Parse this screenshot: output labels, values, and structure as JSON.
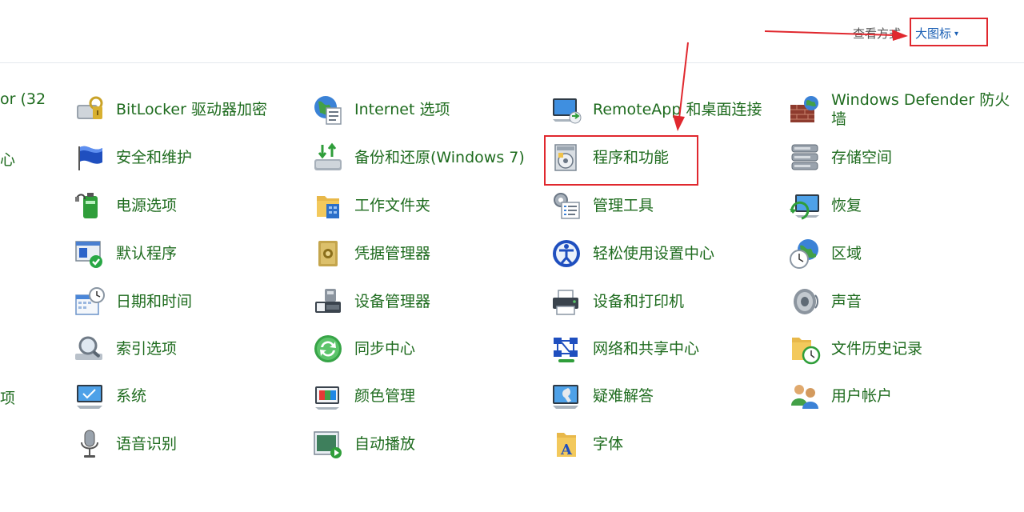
{
  "header": {
    "view_by_label": "查看方式",
    "view_by_value": "大图标"
  },
  "partial_left": [
    "or (32",
    "心",
    "项"
  ],
  "columns": [
    [
      {
        "label": "BitLocker 驱动器加密",
        "icon": "bitlocker-icon"
      },
      {
        "label": "安全和维护",
        "icon": "security-flag-icon"
      },
      {
        "label": "电源选项",
        "icon": "power-battery-icon"
      },
      {
        "label": "默认程序",
        "icon": "default-programs-icon"
      },
      {
        "label": "日期和时间",
        "icon": "calendar-clock-icon"
      },
      {
        "label": "索引选项",
        "icon": "indexing-magnifier-icon"
      },
      {
        "label": "系统",
        "icon": "system-monitor-icon"
      },
      {
        "label": "语音识别",
        "icon": "microphone-icon"
      }
    ],
    [
      {
        "label": "Internet 选项",
        "icon": "internet-globe-icon"
      },
      {
        "label": "备份和还原(Windows 7)",
        "icon": "backup-restore-icon"
      },
      {
        "label": "工作文件夹",
        "icon": "work-folders-icon"
      },
      {
        "label": "凭据管理器",
        "icon": "credential-safe-icon"
      },
      {
        "label": "设备管理器",
        "icon": "device-manager-icon"
      },
      {
        "label": "同步中心",
        "icon": "sync-center-icon"
      },
      {
        "label": "颜色管理",
        "icon": "color-management-icon"
      },
      {
        "label": "自动播放",
        "icon": "autoplay-icon"
      }
    ],
    [
      {
        "label": "RemoteApp 和桌面连接",
        "icon": "remote-desktop-icon"
      },
      {
        "label": "程序和功能",
        "icon": "programs-features-icon"
      },
      {
        "label": "管理工具",
        "icon": "admin-tools-icon"
      },
      {
        "label": "轻松使用设置中心",
        "icon": "ease-of-access-icon"
      },
      {
        "label": "设备和打印机",
        "icon": "printer-icon"
      },
      {
        "label": "网络和共享中心",
        "icon": "network-sharing-icon"
      },
      {
        "label": "疑难解答",
        "icon": "troubleshooting-icon"
      },
      {
        "label": "字体",
        "icon": "fonts-folder-icon"
      }
    ],
    [
      {
        "label": "Windows Defender 防火墙",
        "icon": "firewall-icon"
      },
      {
        "label": "存储空间",
        "icon": "storage-spaces-icon"
      },
      {
        "label": "恢复",
        "icon": "recovery-icon"
      },
      {
        "label": "区域",
        "icon": "region-globe-clock-icon"
      },
      {
        "label": "声音",
        "icon": "speaker-icon"
      },
      {
        "label": "文件历史记录",
        "icon": "file-history-icon"
      },
      {
        "label": "用户帐户",
        "icon": "user-accounts-icon"
      }
    ]
  ],
  "colors": {
    "link_green": "#1e6b1e",
    "link_blue": "#1a5fb4",
    "annotation_red": "#e0282e"
  }
}
